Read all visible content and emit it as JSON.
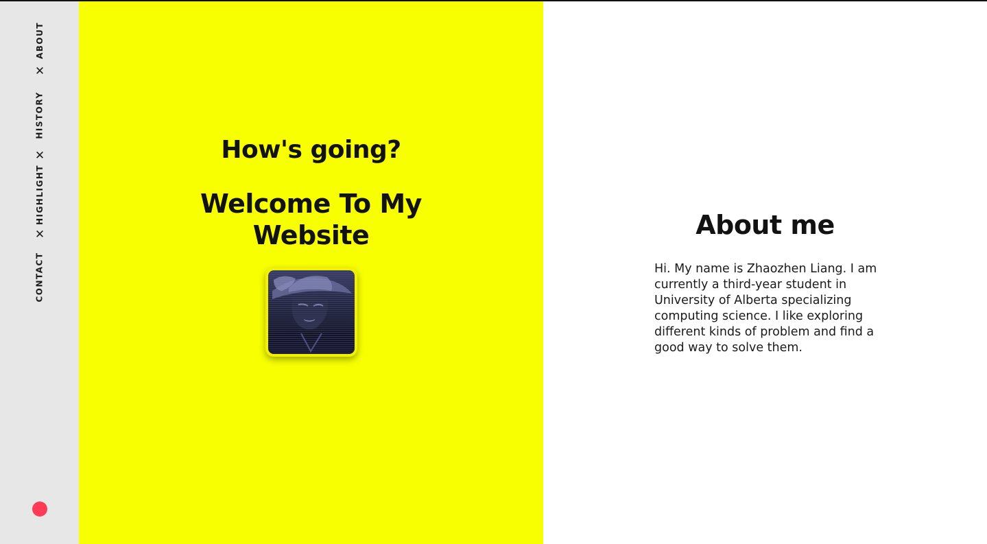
{
  "sidebar": {
    "nav_items": [
      {
        "label": "ABOUT"
      },
      {
        "label": "HISTORY"
      },
      {
        "label": "HIGHLIGHT"
      },
      {
        "label": "CONTACT"
      }
    ],
    "separator": "✕",
    "status_dot_color": "#ff3b57",
    "background": "#e7e7e7"
  },
  "hero": {
    "greeting": "How's going?",
    "welcome": "Welcome To My Website",
    "background": "#f8ff00",
    "avatar_icon": "avatar-photo"
  },
  "about": {
    "title": "About me",
    "text": "Hi. My name is Zhaozhen Liang. I am currently a third-year student in University of Alberta specializing computing science. I like exploring different kinds of problem and find a good way to solve them."
  }
}
